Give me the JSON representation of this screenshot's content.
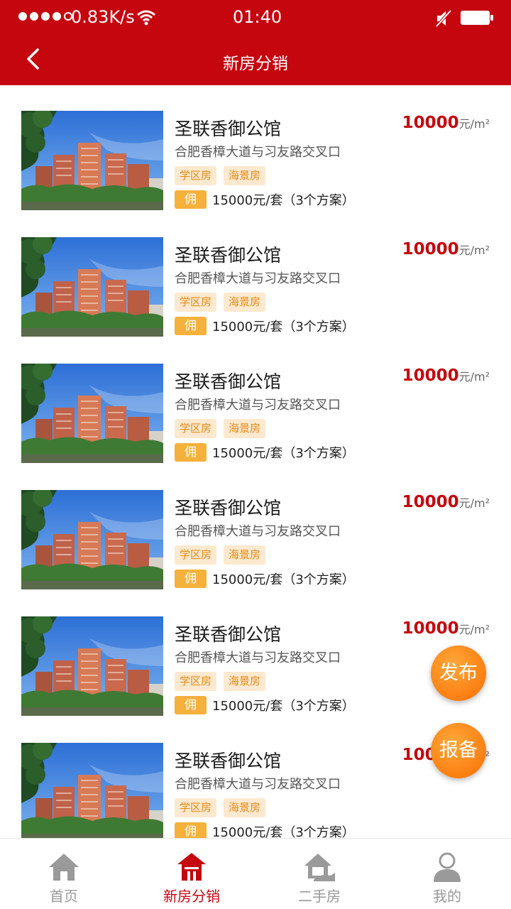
{
  "status_bar": {
    "speed": "0.83K/s",
    "time": "01:40"
  },
  "header": {
    "title": "新房分销",
    "back_icon": "chevron-left-icon"
  },
  "listings": [
    {
      "name": "圣联香御公馆",
      "address": "合肥香樟大道与习友路交叉口",
      "tags": [
        "学区房",
        "海景房"
      ],
      "commission_badge": "佣",
      "commission": "15000元/套（3个方案）",
      "price": "10000",
      "price_unit": "元/m²"
    },
    {
      "name": "圣联香御公馆",
      "address": "合肥香樟大道与习友路交叉口",
      "tags": [
        "学区房",
        "海景房"
      ],
      "commission_badge": "佣",
      "commission": "15000元/套（3个方案）",
      "price": "10000",
      "price_unit": "元/m²"
    },
    {
      "name": "圣联香御公馆",
      "address": "合肥香樟大道与习友路交叉口",
      "tags": [
        "学区房",
        "海景房"
      ],
      "commission_badge": "佣",
      "commission": "15000元/套（3个方案）",
      "price": "10000",
      "price_unit": "元/m²"
    },
    {
      "name": "圣联香御公馆",
      "address": "合肥香樟大道与习友路交叉口",
      "tags": [
        "学区房",
        "海景房"
      ],
      "commission_badge": "佣",
      "commission": "15000元/套（3个方案）",
      "price": "10000",
      "price_unit": "元/m²"
    },
    {
      "name": "圣联香御公馆",
      "address": "合肥香樟大道与习友路交叉口",
      "tags": [
        "学区房",
        "海景房"
      ],
      "commission_badge": "佣",
      "commission": "15000元/套（3个方案）",
      "price": "10000",
      "price_unit": "元/m²"
    },
    {
      "name": "圣联香御公馆",
      "address": "合肥香樟大道与习友路交叉口",
      "tags": [
        "学区房",
        "海景房"
      ],
      "commission_badge": "佣",
      "commission": "15000元/套（3个方案）",
      "price": "10000",
      "price_unit": "元/m²"
    }
  ],
  "floating_buttons": {
    "publish": "发布",
    "report": "报备"
  },
  "tabbar": {
    "items": [
      {
        "label": "首页",
        "icon": "home-icon",
        "active": false
      },
      {
        "label": "新房分销",
        "icon": "new-house-icon",
        "active": true
      },
      {
        "label": "二手房",
        "icon": "second-hand-house-icon",
        "active": false
      },
      {
        "label": "我的",
        "icon": "user-icon",
        "active": false
      }
    ]
  },
  "colors": {
    "brand": "#c5060f",
    "tag_bg": "#fde9cf",
    "tag_text": "#e58a16",
    "commission_badge": "#f5b13b",
    "fab": "#fb7f12",
    "tab_inactive": "#999999"
  }
}
